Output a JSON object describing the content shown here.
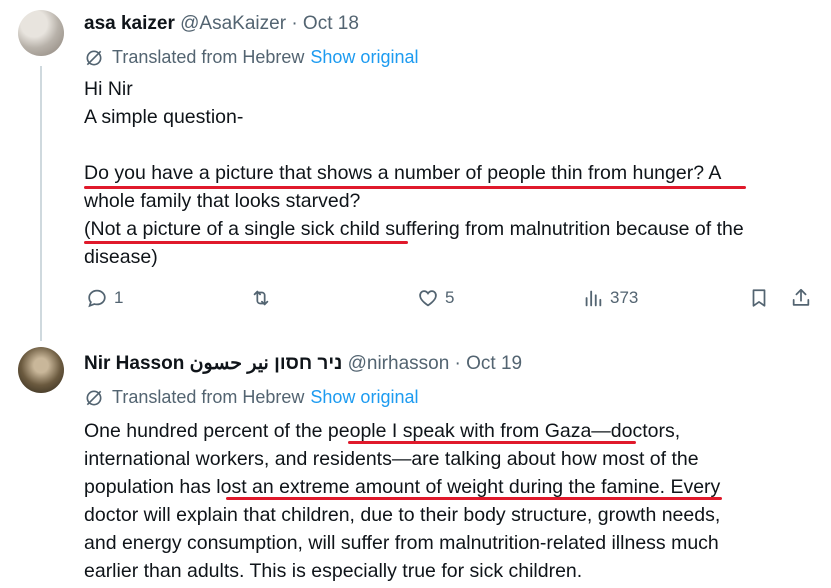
{
  "tweet1": {
    "display_name": "asa kaizer",
    "handle": "@AsaKaizer",
    "separator": "·",
    "date": "Oct 18",
    "translated_label": "Translated from Hebrew",
    "show_original": "Show original",
    "lines": [
      "Hi Nir",
      "A simple question-",
      "",
      "Do you have a picture that shows a number of people thin from hunger? A",
      "whole family that looks starved?",
      "(Not a picture of a single sick child suffering from malnutrition because of the",
      "disease)"
    ],
    "actions": {
      "reply_count": "1",
      "retweet_count": "",
      "like_count": "5",
      "views_count": "373"
    }
  },
  "tweet2": {
    "display_name": "Nir Hasson ניר חסון نير حسون",
    "handle": "@nirhasson",
    "separator": "·",
    "date": "Oct 19",
    "translated_label": "Translated from Hebrew",
    "show_original": "Show original",
    "lines": [
      "One hundred percent of the people I speak with from Gaza—doctors,",
      "international workers, and residents—are talking about how most of the",
      "population has lost an extreme amount of weight during the famine. Every",
      "doctor will explain that children, due to their body structure, growth needs,",
      "and energy consumption, will suffer from malnutrition-related illness much",
      "earlier than adults. This is especially true for sick children."
    ]
  },
  "colors": {
    "text": "#0f1419",
    "muted": "#536471",
    "link": "#1d9bf0",
    "underline": "#e0192b",
    "thread_line": "#cfd9de"
  }
}
